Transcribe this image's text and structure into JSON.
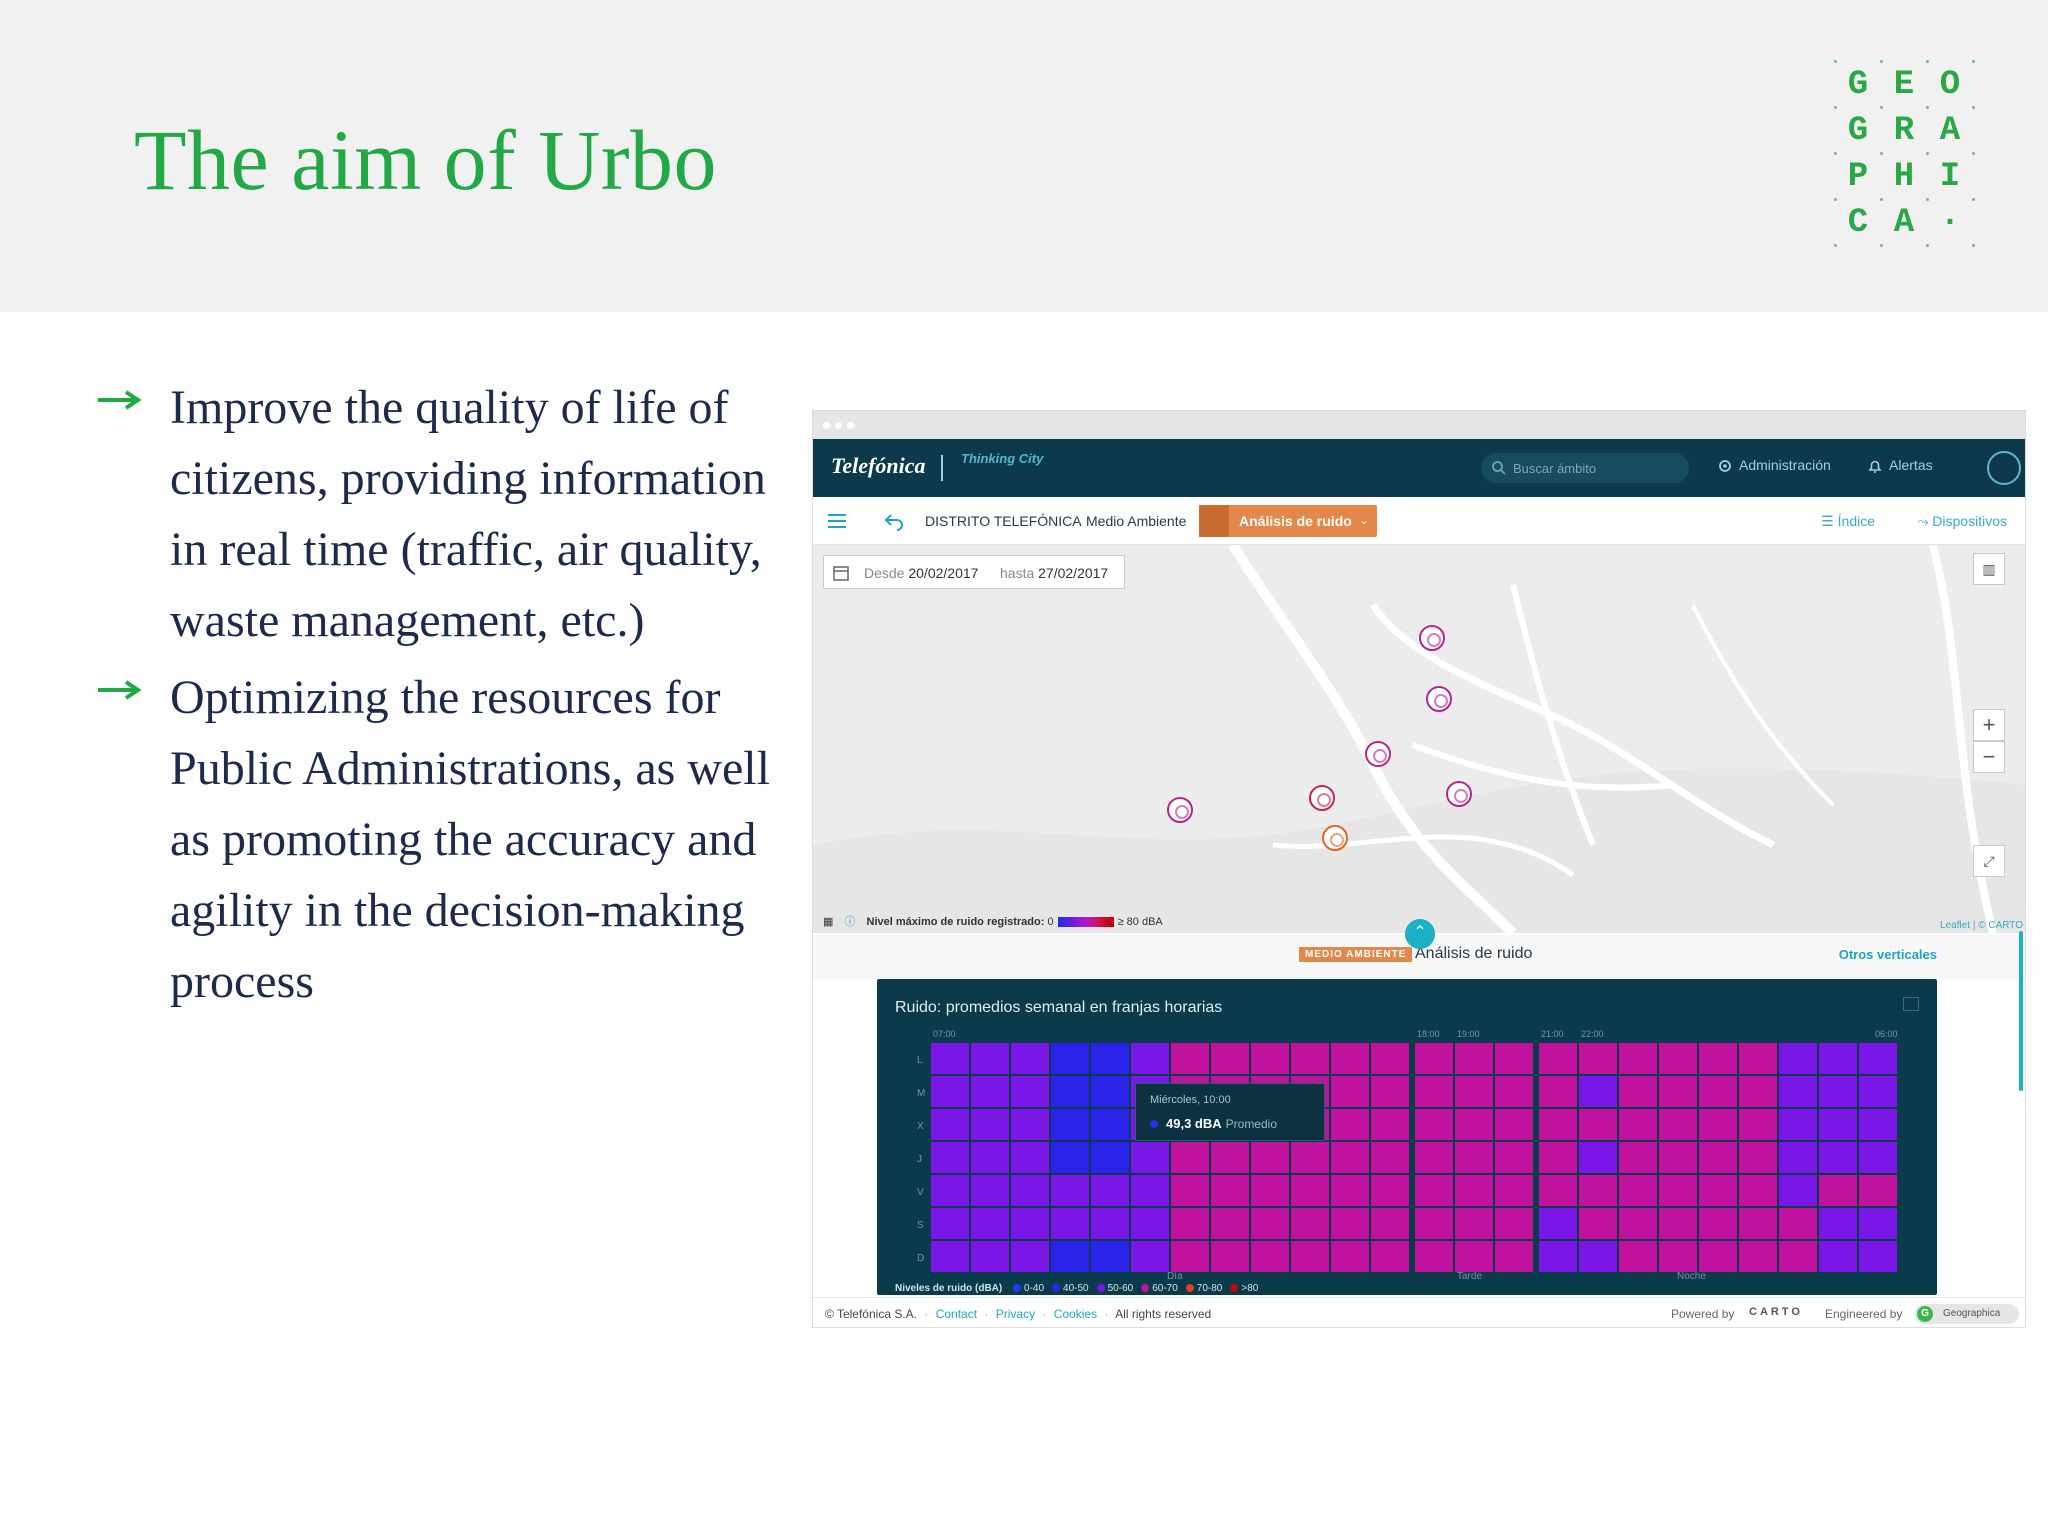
{
  "slide": {
    "title": "The aim of Urbo",
    "logo_letters": [
      "G",
      "E",
      "O",
      "G",
      "R",
      "A",
      "P",
      "H",
      "I",
      "C",
      "A",
      "·"
    ],
    "accent_color": "#22a845",
    "bullets": [
      "Improve the quality of life of citizens, providing information in real time (traffic, air quality, waste management, etc.)",
      "Optimizing the resources for Public Administrations, as well as promoting the accuracy and agility in the decision-making process"
    ]
  },
  "app": {
    "brand": "Telefónica",
    "brand_sub": "Thinking City",
    "search_placeholder": "Buscar ámbito",
    "nav_admin": "Administración",
    "nav_alerts": "Alertas",
    "breadcrumb_main": "DISTRITO TELEFÓNICA",
    "breadcrumb_sep": "·",
    "breadcrumb_sub": "Medio Ambiente",
    "dropdown_label": "Análisis de ruido",
    "link_index": "Índice",
    "link_devices": "Dispositivos",
    "date_from_label": "Desde",
    "date_from": "20/02/2017",
    "date_to_label": "hasta",
    "date_to": "27/02/2017",
    "zoom_in": "+",
    "zoom_out": "−",
    "map_legend_label": "Nivel máximo de ruido registrado:",
    "map_legend_min": "0",
    "map_legend_max": "≥ 80 dBA",
    "map_attribution": "Leaflet | © CARTO",
    "panel_tag": "MEDIO AMBIENTE",
    "panel_title": "Análisis de ruido",
    "panel_other": "Otros verticales",
    "footer_copyright": "© Telefónica S.A.",
    "footer_links": [
      "Contact",
      "Privacy",
      "Cookies"
    ],
    "footer_rights": "All rights reserved",
    "footer_powered": "Powered by",
    "footer_carto": "CARTO",
    "footer_engineered": "Engineered by",
    "footer_geo": "Geographica"
  },
  "chart_data": {
    "type": "heatmap",
    "title": "Ruido: promedios semanal en franjas horarias",
    "y_categories": [
      "L",
      "M",
      "X",
      "J",
      "V",
      "S",
      "D"
    ],
    "time_ticks": [
      "07:00",
      "18:00",
      "19:00",
      "21:00",
      "22:00",
      "06:00"
    ],
    "period_labels": [
      "Día",
      "Tarde",
      "Noche"
    ],
    "legend_title": "Niveles de ruido (dBA)",
    "legend": [
      {
        "label": "0-40",
        "color": "#1f3bf0"
      },
      {
        "label": "40-50",
        "color": "#2a24ea"
      },
      {
        "label": "50-60",
        "color": "#7a16e6"
      },
      {
        "label": "60-70",
        "color": "#c0129e"
      },
      {
        "label": "70-80",
        "color": "#e0401a"
      },
      {
        "label": ">80",
        "color": "#b80b0b"
      }
    ],
    "level_colors": {
      "1": "#2a24ea",
      "2": "#7a16e6",
      "3": "#c0129e"
    },
    "rows": [
      [
        2,
        2,
        2,
        1,
        1,
        2,
        3,
        3,
        3,
        3,
        3,
        3,
        3,
        3,
        3,
        3,
        3,
        3,
        3,
        3,
        3,
        2,
        2,
        2
      ],
      [
        2,
        2,
        2,
        1,
        1,
        2,
        3,
        3,
        3,
        3,
        3,
        3,
        3,
        3,
        3,
        3,
        2,
        3,
        3,
        3,
        3,
        2,
        2,
        2
      ],
      [
        2,
        2,
        2,
        1,
        1,
        2,
        3,
        3,
        3,
        3,
        3,
        3,
        3,
        3,
        3,
        3,
        3,
        3,
        3,
        3,
        3,
        2,
        2,
        2
      ],
      [
        2,
        2,
        2,
        1,
        1,
        2,
        3,
        3,
        3,
        3,
        3,
        3,
        3,
        3,
        3,
        3,
        2,
        3,
        3,
        3,
        3,
        2,
        2,
        2
      ],
      [
        2,
        2,
        2,
        2,
        2,
        2,
        3,
        3,
        3,
        3,
        3,
        3,
        3,
        3,
        3,
        3,
        3,
        3,
        3,
        3,
        3,
        2,
        3,
        3
      ],
      [
        2,
        2,
        2,
        2,
        2,
        2,
        3,
        3,
        3,
        3,
        3,
        3,
        3,
        3,
        3,
        2,
        3,
        3,
        3,
        3,
        3,
        3,
        2,
        2
      ],
      [
        2,
        2,
        2,
        1,
        1,
        2,
        3,
        3,
        3,
        3,
        3,
        3,
        3,
        3,
        3,
        2,
        2,
        3,
        3,
        3,
        3,
        3,
        2,
        2
      ]
    ],
    "tooltip": {
      "day": "Miércoles, 10:00",
      "value": "49,3 dBA",
      "suffix": "Promedio"
    }
  }
}
